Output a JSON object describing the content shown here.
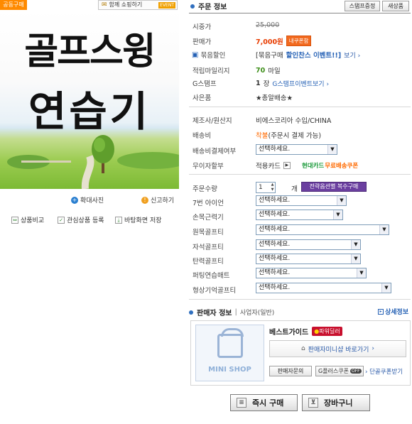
{
  "left": {
    "badge": "공동구매",
    "share_label": "함께 쇼핑하기",
    "share_event": "EVENT",
    "image_title_line1": "골프스윙",
    "image_title_line2": "연습기",
    "zoom_link": "확대사진",
    "report_link": "신고하기",
    "compare_link": "상품비교",
    "wishlist_link": "관심상품 등록",
    "desktop_link": "바탕화면 저장"
  },
  "order": {
    "title": "주문 정보",
    "stamp_button": "스탬프증정",
    "new_button": "새상품",
    "market_price_label": "시중가",
    "market_price": "25,000",
    "sale_price_label": "판매가",
    "sale_price": "7,000원",
    "coupon_tag": "내쿠폰함",
    "bundle_label": "묶음할인",
    "bundle_text_prefix": "[묶음구매",
    "bundle_text_highlight": "할인찬스 이벤트!!]",
    "bundle_more": "보기",
    "mileage_label": "적립마일리지",
    "mileage_value": "70",
    "mileage_unit": "마일",
    "stamp_label": "G스탬프",
    "stamp_count": "1",
    "stamp_unit": "장",
    "stamp_event": "G스탬프이벤트보기",
    "gift_label": "사은품",
    "gift_value": "★총알배송★",
    "maker_label": "제조사/원산지",
    "maker_value": "비에스코리아 수입/CHINA",
    "shipping_label": "배송비",
    "shipping_cod": "착불",
    "shipping_note": "(주문시 결제 가능)",
    "ship_pay_label": "배송비결제여부",
    "select_placeholder": "선택하세요.",
    "installment_label": "무이자할부",
    "installment_value": "적용카드",
    "card_promo_prefix": "현대카드",
    "card_promo": "무료배송쿠폰",
    "qty_label": "주문수량",
    "qty_value": "1",
    "qty_unit": "개",
    "qty_tag": "전략옵션별 복수구매",
    "options": [
      {
        "label": "7번 아이언"
      },
      {
        "label": "손목근력기"
      },
      {
        "label": "원목골프티"
      },
      {
        "label": "자석골프티"
      },
      {
        "label": "탄력골프티"
      },
      {
        "label": "퍼팅연습매트"
      },
      {
        "label": "형상기억골프티"
      }
    ]
  },
  "seller": {
    "title": "판매자 정보",
    "type": "사업자(일반)",
    "detail_link": "상세정보",
    "minishop_logo": "MINI SHOP",
    "name": "베스트가이드",
    "power_badge": "파워딜러",
    "minishop_button": "판매자미니샵 바로가기",
    "inquiry_button": "판매자문의",
    "gplus_coupon": "G플러스쿠폰",
    "gplus_badge": "OFF",
    "single_coupon": "단골쿠폰받기"
  },
  "actions": {
    "buy_now": "즉시 구매",
    "cart": "장바구니"
  }
}
